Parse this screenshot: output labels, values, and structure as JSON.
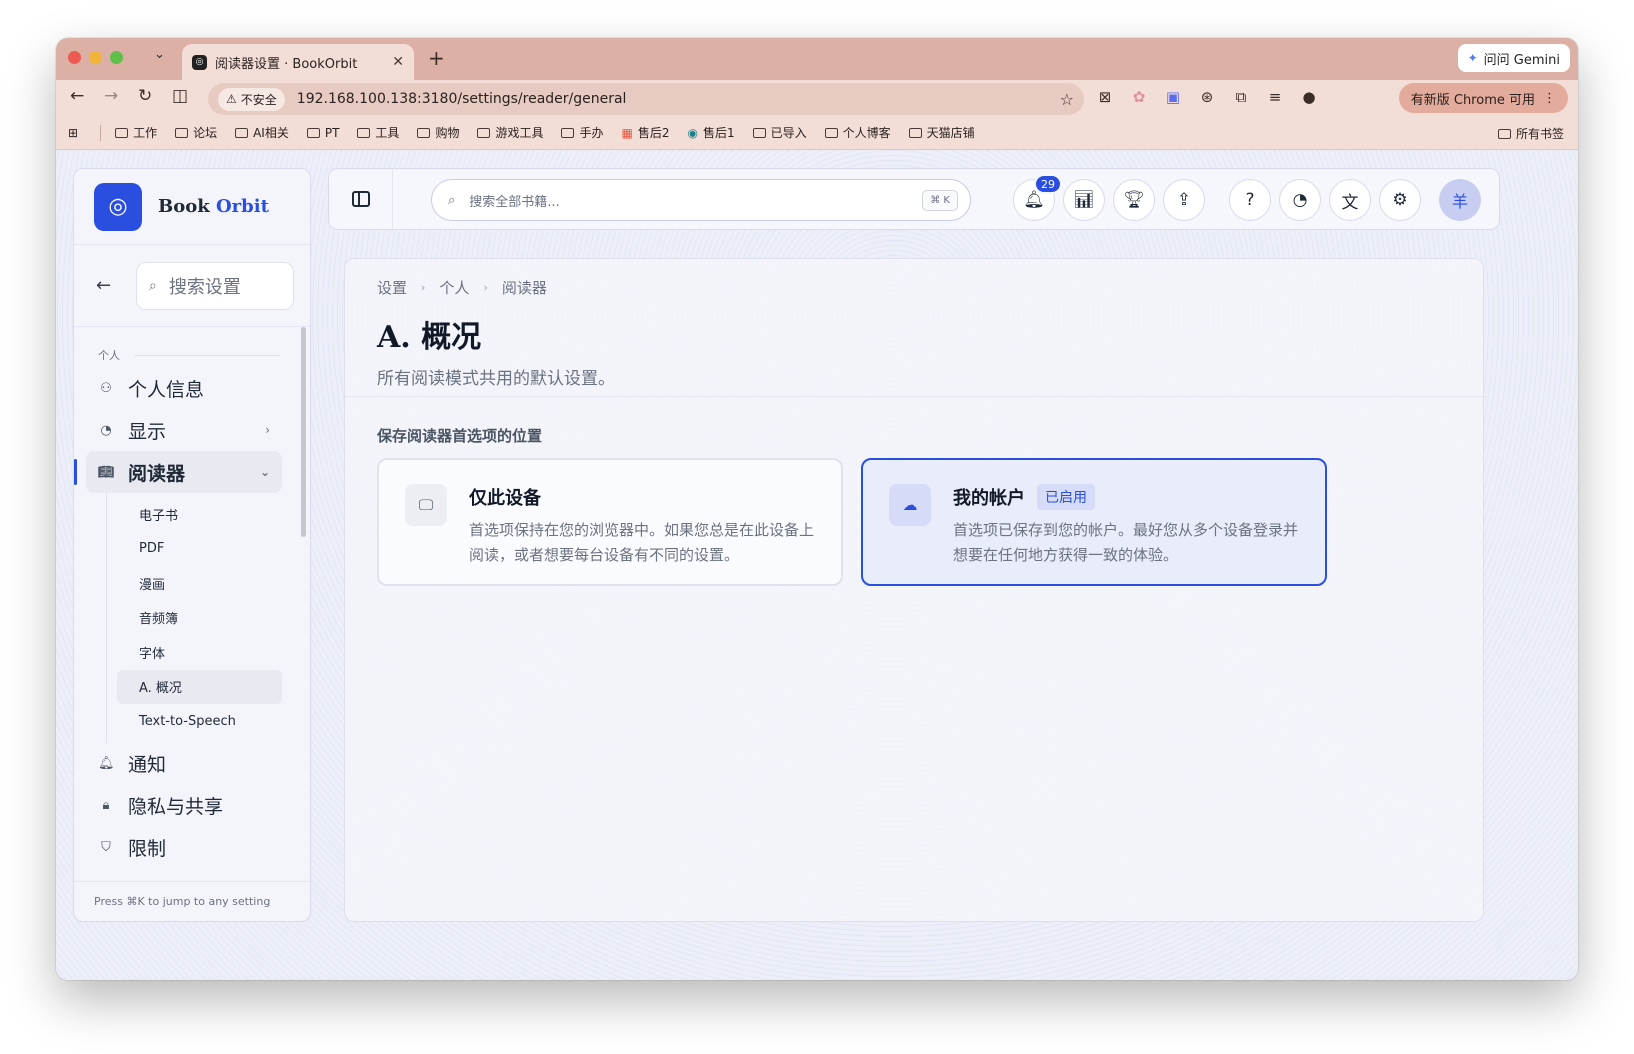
{
  "browser": {
    "tab_title": "阅读器设置 · BookOrbit",
    "gemini_label": "问问 Gemini",
    "insecure_label": "不安全",
    "url": "192.168.100.138:3180/settings/reader/general",
    "update_label": "有新版 Chrome 可用",
    "bookmarks": [
      "工作",
      "论坛",
      "AI相关",
      "PT",
      "工具",
      "购物",
      "游戏工具",
      "手办",
      "售后2",
      "售后1",
      "已导入",
      "个人博客",
      "天猫店铺"
    ],
    "all_bookmarks": "所有书签"
  },
  "brand": {
    "name_part1": "Book",
    "name_part2": "Orbit"
  },
  "sidebar": {
    "search_placeholder": "搜索设置",
    "section": "个人",
    "items": [
      {
        "label": "个人信息",
        "icon": "user-icon"
      },
      {
        "label": "显示",
        "icon": "palette-icon"
      },
      {
        "label": "阅读器",
        "icon": "book-open-icon"
      },
      {
        "label": "通知",
        "icon": "bell-icon"
      },
      {
        "label": "隐私与共享",
        "icon": "lock-icon"
      },
      {
        "label": "限制",
        "icon": "shield-icon"
      }
    ],
    "reader_sub": [
      "电子书",
      "PDF",
      "漫画",
      "音频簿",
      "字体",
      "A. 概况",
      "Text-to-Speech"
    ],
    "footer": "Press ⌘K to jump to any setting"
  },
  "topbar": {
    "search_placeholder": "搜索全部书籍...",
    "shortcut": "⌘ K",
    "notification_count": "29",
    "avatar_initial": "羊"
  },
  "main": {
    "breadcrumb": [
      "设置",
      "个人",
      "阅读器"
    ],
    "title": "A. 概况",
    "subtitle": "所有阅读模式共用的默认设置。",
    "field_label": "保存阅读器首选项的位置",
    "options": [
      {
        "title": "仅此设备",
        "desc": "首选项保持在您的浏览器中。如果您总是在此设备上阅读，或者想要每台设备有不同的设置。",
        "selected": false
      },
      {
        "title": "我的帐户",
        "badge": "已启用",
        "desc": "首选项已保存到您的帐户。最好您从多个设备登录并想要在任何地方获得一致的体验。",
        "selected": true
      }
    ]
  },
  "colors": {
    "accent": "#2a4fe0",
    "tab_strip": "#dcb0a4"
  }
}
